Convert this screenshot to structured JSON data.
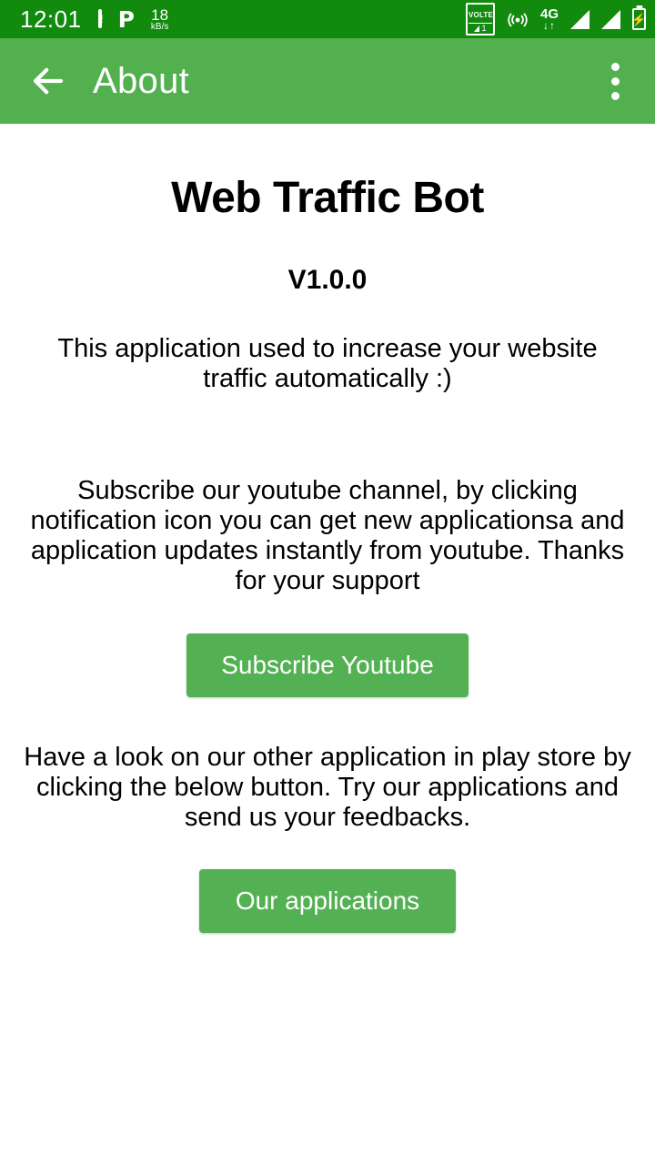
{
  "status_bar": {
    "time": "12:01",
    "phone_alert_icon": "phone-alert-icon",
    "pocket_icon": "P",
    "net_speed_value": "18",
    "net_speed_unit": "kB/s",
    "volte_label": "VOLTE",
    "volte_sim": "1",
    "hotspot_icon": "hotspot-icon",
    "network_type": "4G",
    "network_arrows": "↓↑",
    "signal_1_icon": "signal-bars-icon",
    "signal_2_icon": "signal-bars-icon",
    "battery_icon": "battery-charging-icon",
    "battery_bolt": "⚡",
    "background_color": "#118A0E"
  },
  "app_bar": {
    "back_label": "back-arrow",
    "title": "About",
    "overflow_label": "more-options",
    "background_color": "#53B04E"
  },
  "content": {
    "app_name": "Web Traffic Bot",
    "version": "V1.0.0",
    "description": "This application used to increase your website traffic automatically :)",
    "youtube_paragraph": "Subscribe our youtube channel, by clicking notification icon you can get new applicationsa and application updates instantly from youtube. Thanks for your support",
    "subscribe_button": "Subscribe Youtube",
    "playstore_paragraph": "Have a look on our other application in play store by clicking the below button. Try our applications and send us your feedbacks.",
    "apps_button": "Our applications",
    "button_color": "#54B153"
  }
}
